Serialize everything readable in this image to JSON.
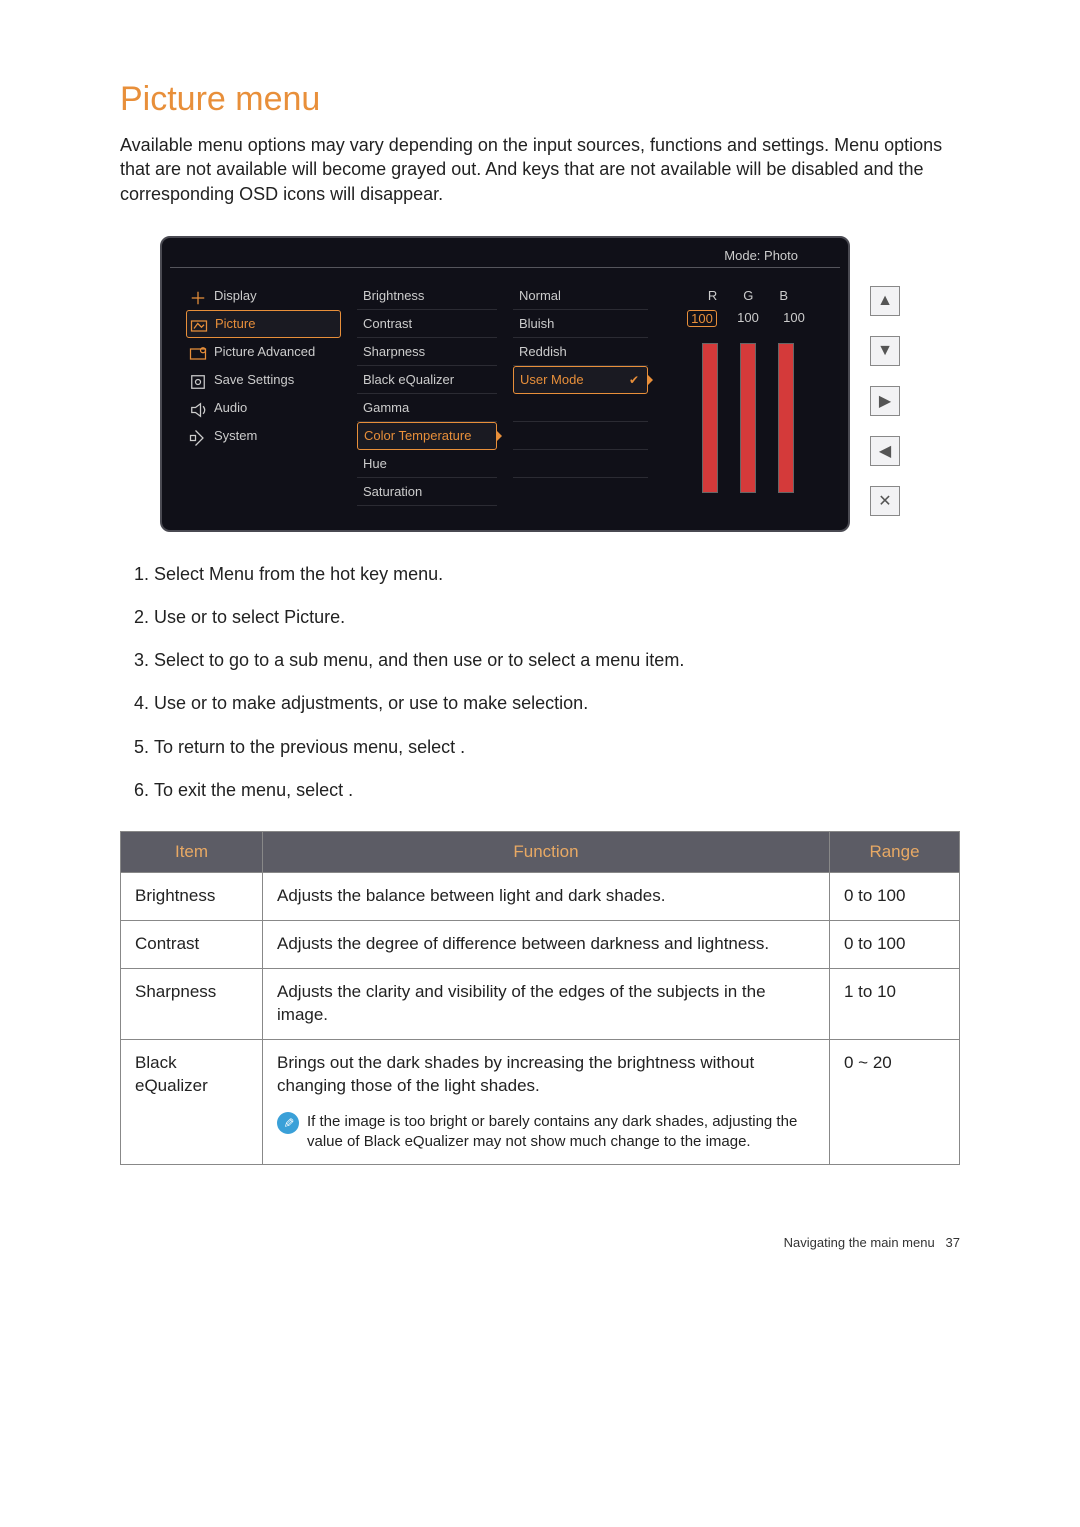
{
  "title": "Picture menu",
  "intro": "Available menu options may vary depending on the input sources, functions and settings. Menu options that are not available will become grayed out. And keys that are not available will be disabled and the corresponding OSD icons will disappear.",
  "osd": {
    "mode_label": "Mode: Photo",
    "main_menu": [
      "Display",
      "Picture",
      "Picture Advanced",
      "Save Settings",
      "Audio",
      "System"
    ],
    "main_active_index": 1,
    "sub_menu": [
      "Brightness",
      "Contrast",
      "Sharpness",
      "Black eQualizer",
      "Gamma",
      "Color Temperature",
      "Hue",
      "Saturation"
    ],
    "sub_active_index": 5,
    "ct_options": [
      "Normal",
      "Bluish",
      "Reddish",
      "User Mode"
    ],
    "ct_selected_index": 3,
    "rgb": {
      "labels": [
        "R",
        "G",
        "B"
      ],
      "values": [
        100,
        100,
        100
      ],
      "selected_index": 0,
      "bar_heights_pct": [
        100,
        100,
        100
      ]
    }
  },
  "side_buttons": [
    "up",
    "down",
    "right",
    "left",
    "close"
  ],
  "steps": [
    {
      "pre": "Select ",
      "kw": "Menu",
      "post": " from the hot key menu."
    },
    {
      "pre": "Use      or      to select ",
      "kw": "Picture",
      "post": "."
    },
    {
      "pre": "Select      to go to a sub menu, and then use      or      to select a menu item.",
      "kw": "",
      "post": ""
    },
    {
      "pre": "Use      or      to make adjustments, or use      to make selection.",
      "kw": "",
      "post": ""
    },
    {
      "pre": "To return to the previous menu, select      .",
      "kw": "",
      "post": ""
    },
    {
      "pre": "To exit the menu, select      .",
      "kw": "",
      "post": ""
    }
  ],
  "table": {
    "headers": [
      "Item",
      "Function",
      "Range"
    ],
    "rows": [
      {
        "item": "Brightness",
        "func": "Adjusts the balance between light and dark shades.",
        "range": "0 to 100"
      },
      {
        "item": "Contrast",
        "func": "Adjusts the degree of difference between darkness and lightness.",
        "range": "0 to 100"
      },
      {
        "item": "Sharpness",
        "func": "Adjusts the clarity and visibility of the edges of the subjects in the image.",
        "range": "1 to 10"
      },
      {
        "item": "Black eQualizer",
        "func_main": "Brings out the dark shades by increasing the brightness without changing those of the light shades.",
        "note_pre": "If the image is too bright or barely contains any dark shades, adjusting the value of ",
        "note_kw": "Black eQualizer",
        "note_post": " may not show much change to the image.",
        "range": "0 ~ 20"
      }
    ]
  },
  "footer": {
    "text": "Navigating the main menu",
    "page": "37"
  }
}
